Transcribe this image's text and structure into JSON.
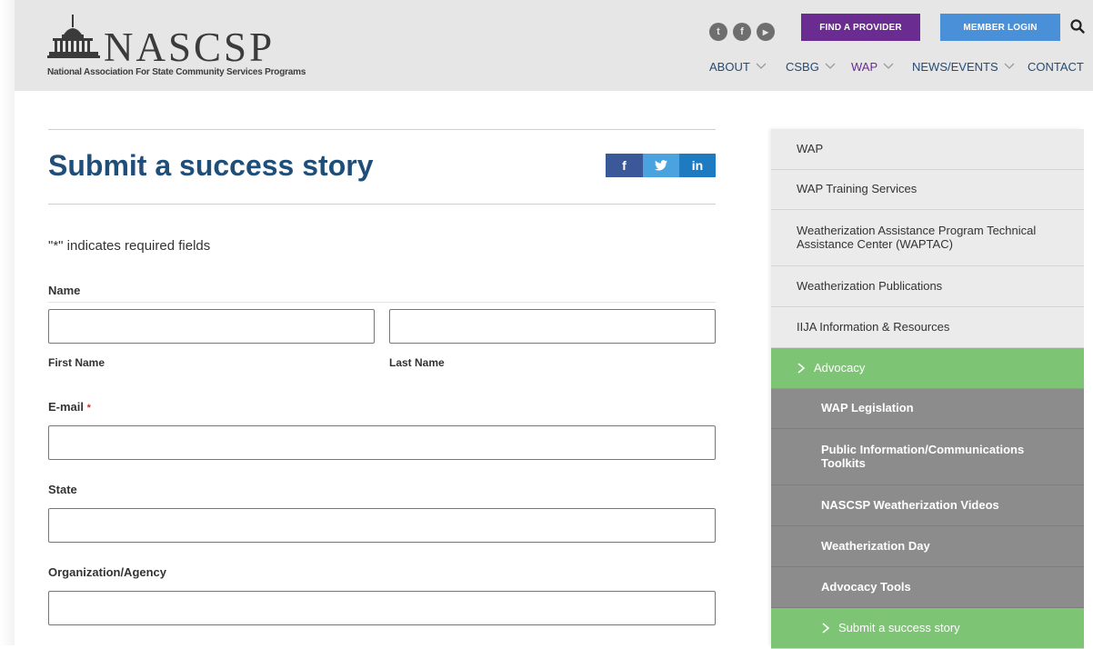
{
  "header": {
    "logo_word": "NASCSP",
    "logo_tagline": "National Association For State Community Services Programs",
    "social": [
      {
        "icon": "twitter-icon",
        "glyph": "t"
      },
      {
        "icon": "facebook-icon",
        "glyph": "f"
      },
      {
        "icon": "youtube-icon",
        "glyph": "▶"
      }
    ],
    "find_provider": "FIND A PROVIDER",
    "member_login": "MEMBER LOGIN",
    "nav": [
      "ABOUT",
      "CSBG",
      "WAP",
      "NEWS/EVENTS",
      "CONTACT"
    ],
    "active_nav": "WAP",
    "colors": {
      "purple": "#6a2c91",
      "blue": "#4a90d9",
      "nav": "#254b77"
    }
  },
  "main": {
    "title": "Submit a success story",
    "share": {
      "facebook": "f",
      "twitter": "t",
      "linkedin": "in"
    },
    "required_note": "\"*\" indicates required fields",
    "fields": {
      "name_label": "Name",
      "first_name": "First Name",
      "last_name": "Last Name",
      "email_label": "E-mail",
      "email_required": "*",
      "state_label": "State",
      "org_label": "Organization/Agency"
    }
  },
  "sidebar": {
    "items": [
      {
        "label": "WAP"
      },
      {
        "label": "WAP Training Services"
      },
      {
        "label": "Weatherization Assistance Program Technical Assistance Center (WAPTAC)"
      },
      {
        "label": "Weatherization Publications"
      },
      {
        "label": "IIJA Information & Resources"
      },
      {
        "label": "Advocacy"
      }
    ],
    "subitems": [
      {
        "label": "WAP Legislation"
      },
      {
        "label": "Public Information/Communications Toolkits"
      },
      {
        "label": "NASCSP Weatherization Videos"
      },
      {
        "label": "Weatherization Day"
      },
      {
        "label": "Advocacy Tools"
      },
      {
        "label": "Submit a success story"
      }
    ],
    "colors": {
      "active": "#7dc474",
      "sub": "#8c8c8c"
    }
  }
}
